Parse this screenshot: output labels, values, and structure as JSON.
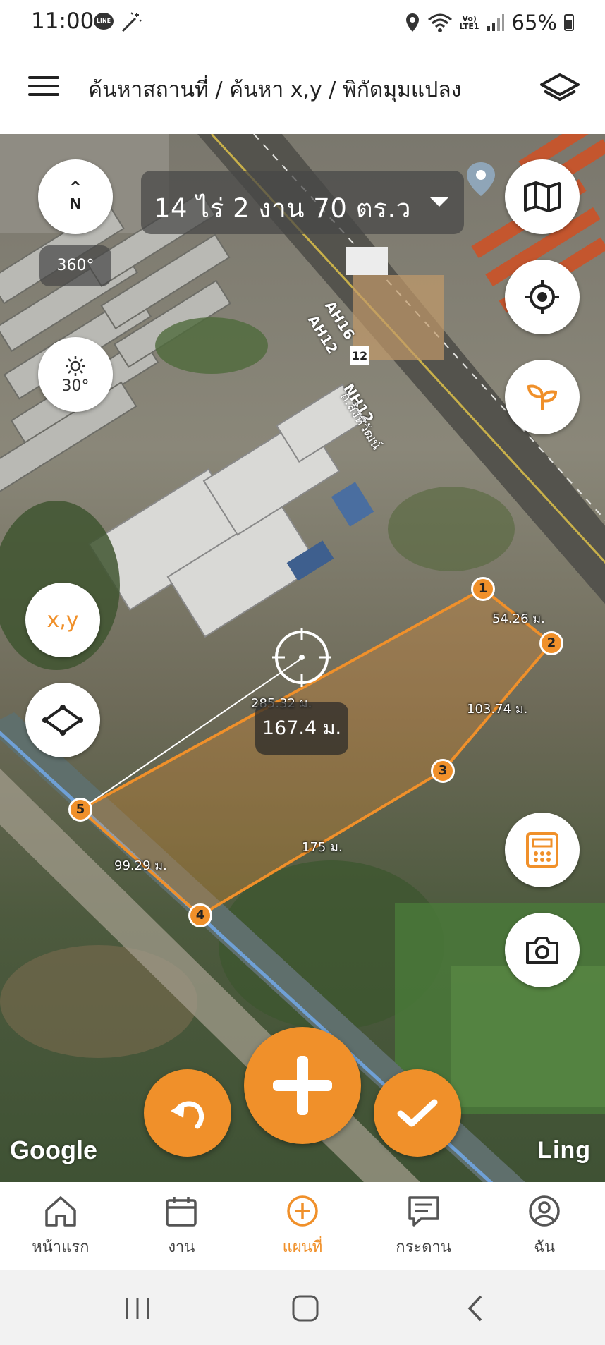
{
  "status_bar": {
    "time": "11:00",
    "line_badge": "LINE",
    "lte_line1": "Vo)",
    "lte_line2": "LTE1",
    "battery": "65%"
  },
  "app_bar": {
    "title": "ค้นหาสถานที่ / ค้นหา x,y / พิกัดมุมแปลง",
    "menu_icon": "hamburger-menu-icon",
    "layers_icon": "layers-icon"
  },
  "map": {
    "area_label": "14 ไร่ 2 งาน 70 ตร.ว",
    "compass_arrow": "^",
    "compass_n": "N",
    "bearing": "360°",
    "pitch": "30°",
    "xy_button": "x,y",
    "distance_readout": "167.4 ม.",
    "edge_lengths": {
      "e12": "54.26 ม.",
      "e23": "103.74 ม.",
      "e34": "175 ม.",
      "e45": "99.29 ม.",
      "e51": "285.32 ม."
    },
    "vertices": [
      "1",
      "2",
      "3",
      "4",
      "5"
    ],
    "attribution": "Google",
    "watermark": "Ling",
    "road_labels": [
      "AH16",
      "AH12",
      "12",
      "NH12",
      "ถ.สิงห์วัฒน์"
    ],
    "accent_color": "#f0902a"
  },
  "bottom_nav": [
    {
      "label": "หน้าแรก",
      "icon": "home-icon"
    },
    {
      "label": "งาน",
      "icon": "calendar-icon"
    },
    {
      "label": "แผนที่",
      "icon": "plus-circle-icon",
      "active": true
    },
    {
      "label": "กระดาน",
      "icon": "board-icon"
    },
    {
      "label": "ฉัน",
      "icon": "profile-icon"
    }
  ]
}
